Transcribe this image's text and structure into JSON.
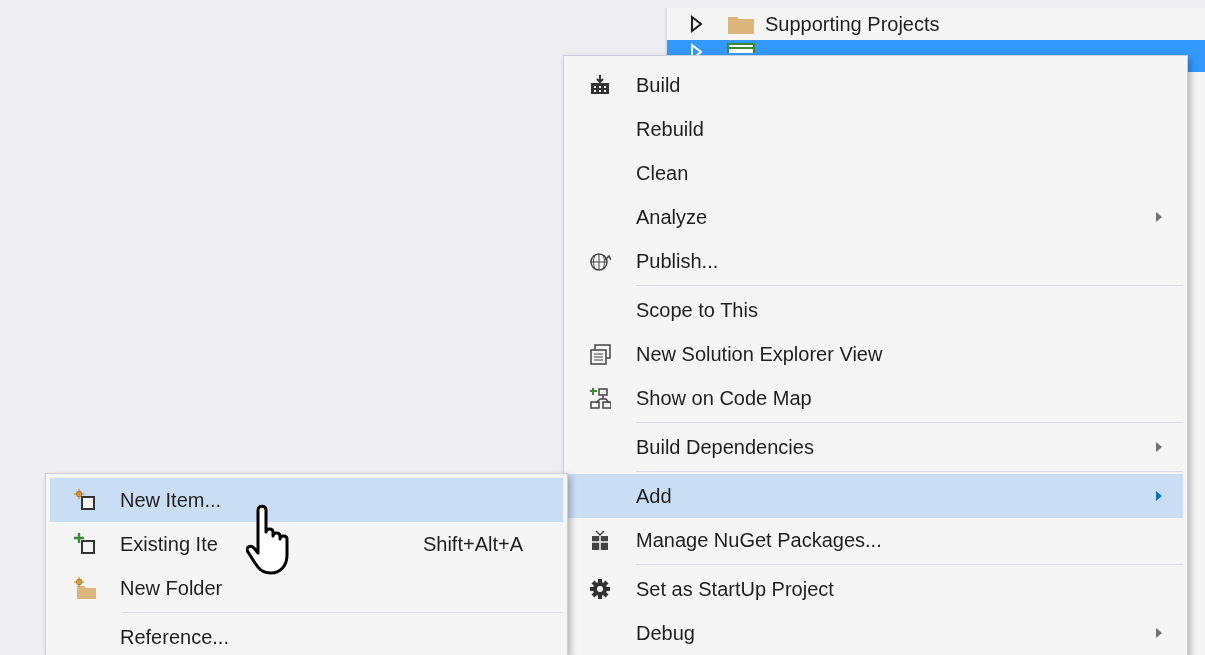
{
  "solution_explorer": {
    "items": [
      {
        "label": "Supporting Projects",
        "expanded": false,
        "selected": false
      },
      {
        "expanded": false,
        "selected": true
      }
    ]
  },
  "context_menu": {
    "items": [
      {
        "kind": "item",
        "label": "Build",
        "submenu": false,
        "selected": false
      },
      {
        "kind": "item",
        "label": "Rebuild",
        "submenu": false,
        "selected": false
      },
      {
        "kind": "item",
        "label": "Clean",
        "submenu": false,
        "selected": false
      },
      {
        "kind": "item",
        "label": "Analyze",
        "submenu": true,
        "selected": false
      },
      {
        "kind": "item",
        "label": "Publish...",
        "submenu": false,
        "selected": false
      },
      {
        "kind": "separator"
      },
      {
        "kind": "item",
        "label": "Scope to This",
        "submenu": false,
        "selected": false
      },
      {
        "kind": "item",
        "label": "New Solution Explorer View",
        "submenu": false,
        "selected": false
      },
      {
        "kind": "item",
        "label": "Show on Code Map",
        "submenu": false,
        "selected": false
      },
      {
        "kind": "separator"
      },
      {
        "kind": "item",
        "label": "Build Dependencies",
        "submenu": true,
        "selected": false
      },
      {
        "kind": "separator"
      },
      {
        "kind": "item",
        "label": "Add",
        "submenu": true,
        "selected": true
      },
      {
        "kind": "item",
        "label": "Manage NuGet Packages...",
        "submenu": false,
        "selected": false
      },
      {
        "kind": "separator"
      },
      {
        "kind": "item",
        "label": "Set as StartUp Project",
        "submenu": false,
        "selected": false
      },
      {
        "kind": "item",
        "label": "Debug",
        "submenu": true,
        "selected": false
      }
    ]
  },
  "add_submenu": {
    "items": [
      {
        "kind": "item",
        "label": "New Item...",
        "selected": true
      },
      {
        "kind": "item",
        "label": "Existing Ite",
        "shortcut": "Shift+Alt+A",
        "selected": false
      },
      {
        "kind": "item",
        "label": "New Folder",
        "selected": false
      },
      {
        "kind": "separator"
      },
      {
        "kind": "item",
        "label": "Reference...",
        "selected": false
      }
    ]
  }
}
